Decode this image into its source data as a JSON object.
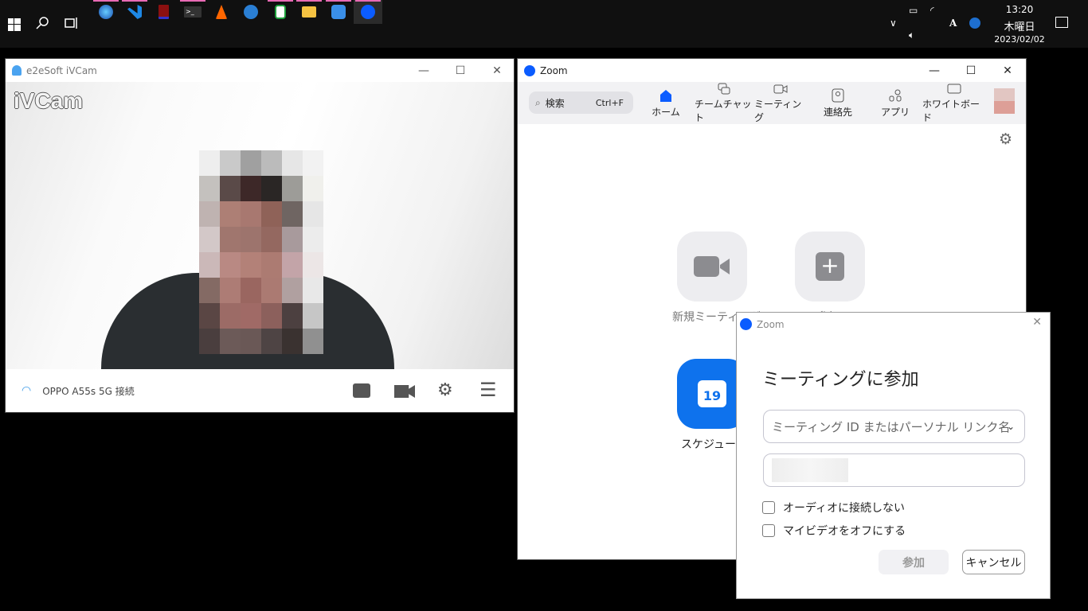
{
  "taskbar": {
    "apps": [
      "start",
      "search",
      "task-view",
      "browser",
      "vscode",
      "book",
      "terminal",
      "vlc",
      "thunderbird",
      "spreadsheet",
      "file-explorer",
      "ivcam",
      "zoom"
    ],
    "clock": {
      "time": "13:20",
      "weekday": "木曜日",
      "date": "2023/02/02"
    },
    "ime": "A"
  },
  "ivcam": {
    "title": "e2eSoft iVCam",
    "logo": "iVCam",
    "status": "OPPO A55s 5G 接続"
  },
  "zoom": {
    "title": "Zoom",
    "search_label": "検索",
    "search_shortcut": "Ctrl+F",
    "tabs": [
      {
        "label": "ホーム"
      },
      {
        "label": "チームチャット"
      },
      {
        "label": "ミーティング"
      },
      {
        "label": "連絡先"
      },
      {
        "label": "アプリ"
      },
      {
        "label": "ホワイトボード"
      }
    ],
    "actions": {
      "new_meeting": "新規ミーティング",
      "join": "参加",
      "schedule": "スケジュール"
    }
  },
  "dialog": {
    "title": "Zoom",
    "heading": "ミーティングに参加",
    "meeting_id_placeholder": "ミーティング ID またはパーソナル リンク名",
    "options": [
      "オーディオに接続しない",
      "マイビデオをオフにする"
    ],
    "join_button": "参加",
    "cancel_button": "キャンセル"
  }
}
